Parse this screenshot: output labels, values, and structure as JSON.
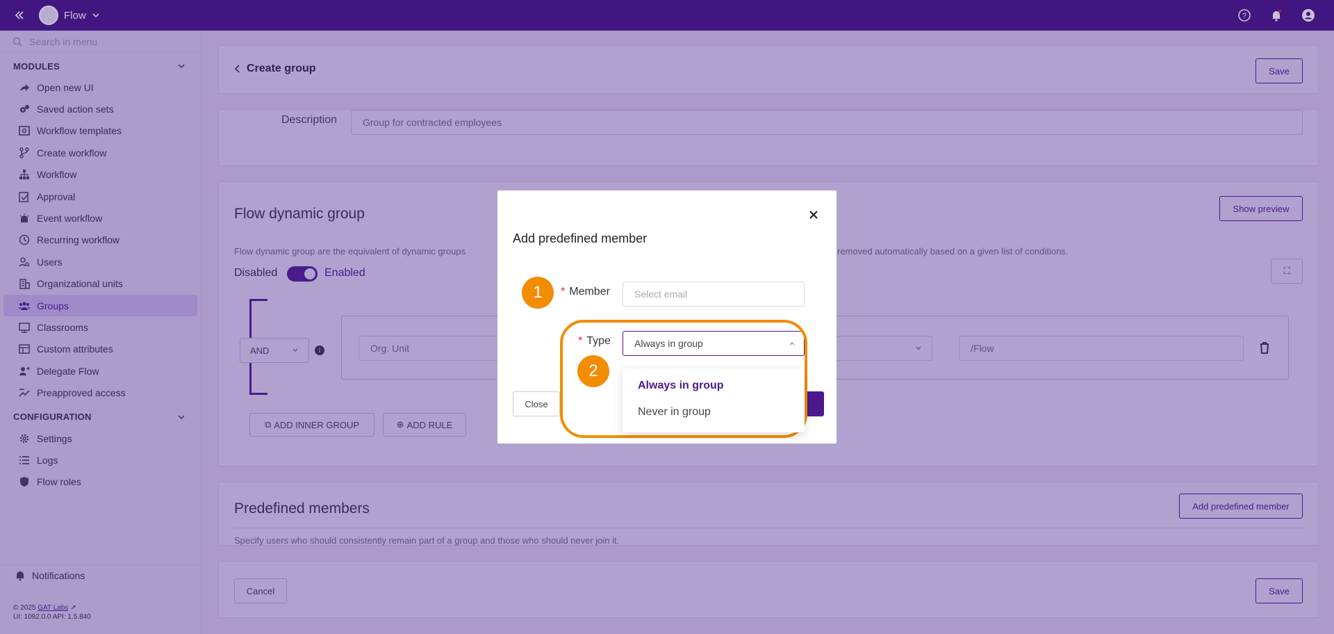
{
  "topbar": {
    "app_name": "Flow"
  },
  "sidebar": {
    "search_placeholder": "Search in menu",
    "modules_label": "MODULES",
    "modules": [
      {
        "label": "Open new UI",
        "icon": "share-icon"
      },
      {
        "label": "Saved action sets",
        "icon": "gears-icon"
      },
      {
        "label": "Workflow templates",
        "icon": "template-icon"
      },
      {
        "label": "Create workflow",
        "icon": "branch-icon"
      },
      {
        "label": "Workflow",
        "icon": "hierarchy-icon"
      },
      {
        "label": "Approval",
        "icon": "approval-icon"
      },
      {
        "label": "Event workflow",
        "icon": "alarm-icon"
      },
      {
        "label": "Recurring workflow",
        "icon": "clock-icon"
      },
      {
        "label": "Users",
        "icon": "user-search-icon"
      },
      {
        "label": "Organizational units",
        "icon": "building-icon"
      },
      {
        "label": "Groups",
        "icon": "group-icon"
      },
      {
        "label": "Classrooms",
        "icon": "classroom-icon"
      },
      {
        "label": "Custom attributes",
        "icon": "attributes-icon"
      },
      {
        "label": "Delegate Flow",
        "icon": "delegate-icon"
      },
      {
        "label": "Preapproved access",
        "icon": "preapproved-icon"
      }
    ],
    "config_label": "CONFIGURATION",
    "config": [
      {
        "label": "Settings",
        "icon": "gear-icon"
      },
      {
        "label": "Logs",
        "icon": "list-icon"
      },
      {
        "label": "Flow roles",
        "icon": "shield-icon"
      }
    ],
    "notifications_label": "Notifications",
    "footer_copyright": "© 2025",
    "footer_company": "GAT Labs",
    "footer_version": "UI: 1092.0.0 API: 1.5.840"
  },
  "page": {
    "back_title": "Create group",
    "save_label": "Save",
    "description_label": "Description",
    "description_value": "Group for contracted employees",
    "dynamic_title": "Flow dynamic group",
    "show_preview_label": "Show preview",
    "dynamic_desc_left": "Flow dynamic group are the equivalent of dynamic groups",
    "dynamic_desc_right": "removed automatically based on a given list of conditions.",
    "disabled_label": "Disabled",
    "enabled_label": "Enabled",
    "and_label": "AND",
    "rule_field": "Org. Unit",
    "rule_value": "/Flow",
    "add_inner_group_label": "ADD INNER GROUP",
    "add_rule_label": "ADD RULE",
    "predefined_title": "Predefined members",
    "add_predefined_label": "Add predefined member",
    "predefined_desc": "Specify users who should consistently remain part of a group and those who should never join it.",
    "cancel_label": "Cancel",
    "save_bottom_label": "Save"
  },
  "modal": {
    "title": "Add predefined member",
    "member_label": "Member",
    "member_placeholder": "Select email",
    "type_label": "Type",
    "type_value": "Always in group",
    "close_label": "Close",
    "badge1": "1",
    "badge2": "2",
    "options": [
      "Always in group",
      "Never in group"
    ]
  }
}
